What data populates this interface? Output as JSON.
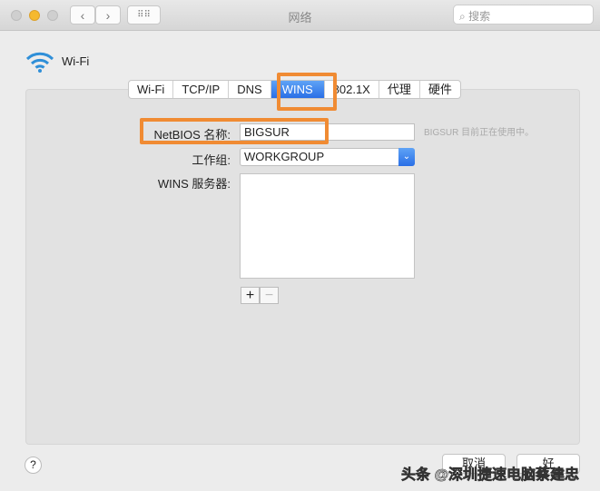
{
  "window": {
    "title": "网络",
    "search_placeholder": "搜索"
  },
  "service": {
    "name": "Wi-Fi"
  },
  "tabs": [
    {
      "label": "Wi-Fi"
    },
    {
      "label": "TCP/IP"
    },
    {
      "label": "DNS"
    },
    {
      "label": "WINS"
    },
    {
      "label": "802.1X"
    },
    {
      "label": "代理"
    },
    {
      "label": "硬件"
    }
  ],
  "form": {
    "netbios_label": "NetBIOS 名称:",
    "netbios_value": "BIGSUR",
    "netbios_status": "BIGSUR 目前正在使用中。",
    "workgroup_label": "工作组:",
    "workgroup_value": "WORKGROUP",
    "wins_label": "WINS 服务器:",
    "add": "+",
    "remove": "−"
  },
  "footer": {
    "help": "?",
    "cancel": "取消",
    "ok": "好"
  },
  "watermark": "头条 @深圳捷速电脑蔡建忠",
  "colors": {
    "accent": "#2a6fe6",
    "highlight": "#f08b33"
  }
}
